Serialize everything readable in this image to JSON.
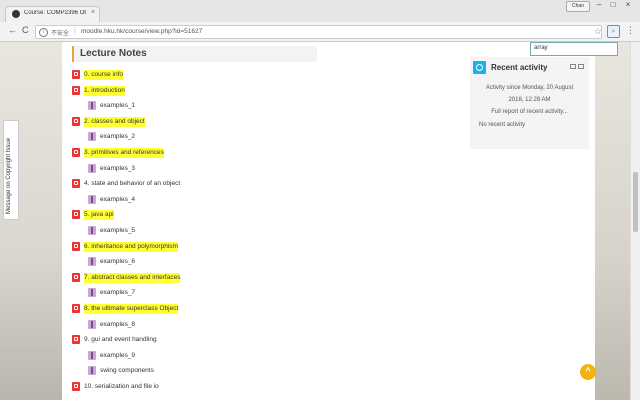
{
  "browser": {
    "tab_title": "Course: COMP2396 Ob...",
    "tab_close": "×",
    "user_badge": "Chan",
    "minimize": "–",
    "maximize": "□",
    "close": "×",
    "back": "←",
    "forward": "→",
    "reload": "C",
    "secure_label": "不安全",
    "url": "moodle.hku.hk/course/view.php?id=51627",
    "star": "☆",
    "find_text": "array",
    "menu": "⋮"
  },
  "sidebar_tab": "Message on Copyright Issue",
  "section": {
    "title": "Lecture Notes",
    "items": [
      {
        "icon": "pdf",
        "label": "0. course info",
        "highlight": true
      },
      {
        "icon": "pdf",
        "label": "1. introduction",
        "highlight": true
      },
      {
        "icon": "zip",
        "label": "examples_1",
        "highlight": false
      },
      {
        "icon": "pdf",
        "label": "2. classes and object",
        "highlight": true
      },
      {
        "icon": "zip",
        "label": "examples_2",
        "highlight": false
      },
      {
        "icon": "pdf",
        "label": "3. primitives and references",
        "highlight": true
      },
      {
        "icon": "zip",
        "label": "examples_3",
        "highlight": false
      },
      {
        "icon": "pdf",
        "label": "4. state and behavior of an object",
        "highlight": false
      },
      {
        "icon": "zip",
        "label": "examples_4",
        "highlight": false
      },
      {
        "icon": "pdf",
        "label": "5. java api",
        "highlight": true
      },
      {
        "icon": "zip",
        "label": "examples_5",
        "highlight": false
      },
      {
        "icon": "pdf",
        "label": "6. inheritance and polymorphism",
        "highlight": true
      },
      {
        "icon": "zip",
        "label": "examples_6",
        "highlight": false
      },
      {
        "icon": "pdf",
        "label": "7. abstract classes and interfaces",
        "highlight": true
      },
      {
        "icon": "zip",
        "label": "examples_7",
        "highlight": false
      },
      {
        "icon": "pdf",
        "label": "8. the ultimate superclass Object",
        "highlight": true
      },
      {
        "icon": "zip",
        "label": "examples_8",
        "highlight": false
      },
      {
        "icon": "pdf",
        "label": "9. gui and event handling",
        "highlight": false
      },
      {
        "icon": "zip",
        "label": "examples_9",
        "highlight": false
      },
      {
        "icon": "zip",
        "label": "swing components",
        "highlight": false
      },
      {
        "icon": "pdf",
        "label": "10. serialization and file io",
        "highlight": false
      }
    ]
  },
  "recent_activity": {
    "title": "Recent activity",
    "since_line1": "Activity since Monday, 20 August",
    "since_line2": "2018, 12:28 AM",
    "full_report": "Full report of recent activity...",
    "none": "No recent activity"
  },
  "scroll_top_icon": "^"
}
